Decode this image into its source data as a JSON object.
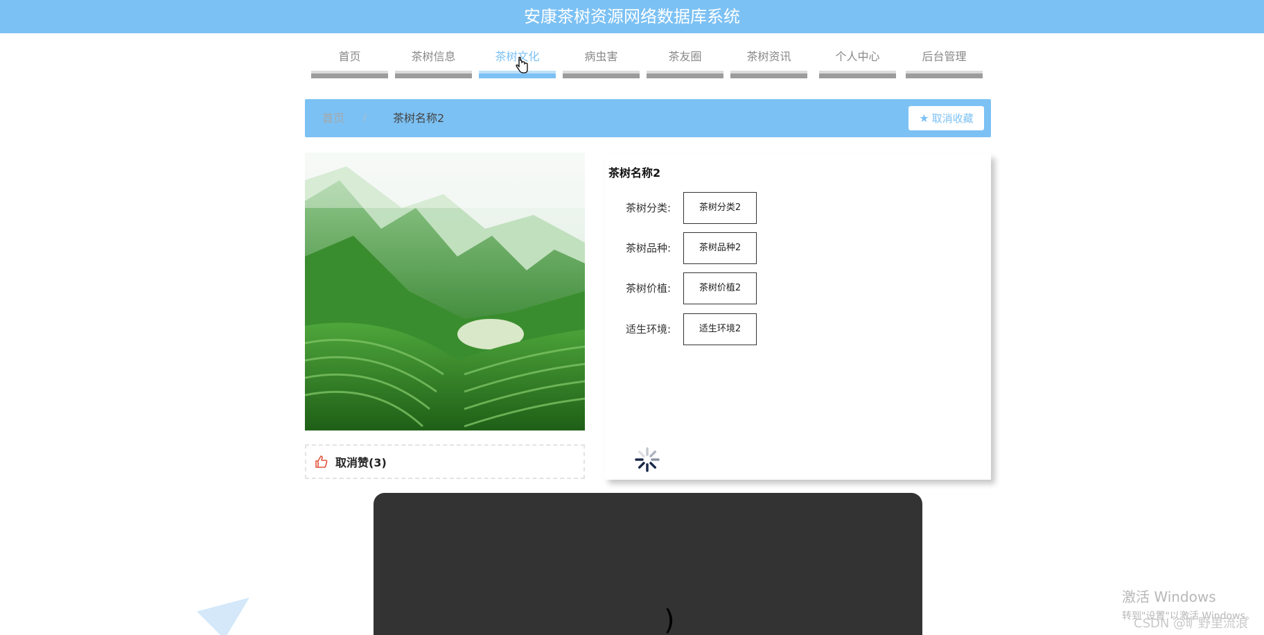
{
  "app": {
    "title": "安康茶树资源网络数据库系统"
  },
  "nav": {
    "items": [
      {
        "label": "首页"
      },
      {
        "label": "茶树信息"
      },
      {
        "label": "茶树文化"
      },
      {
        "label": "病虫害"
      },
      {
        "label": "茶友圈"
      },
      {
        "label": "茶树资讯"
      },
      {
        "label": "个人中心"
      },
      {
        "label": "后台管理"
      }
    ],
    "active_index": 2
  },
  "breadcrumb": {
    "home": "首页",
    "separator": "/",
    "current": "茶树名称2",
    "favorite_button": "取消收藏",
    "favorite_icon": "star-icon"
  },
  "photo": {
    "alt": "tea-plantation-image"
  },
  "like": {
    "label": "取消赞(3)",
    "icon": "thumbs-up-icon"
  },
  "detail": {
    "title": "茶树名称2",
    "fields": [
      {
        "label": "茶树分类:",
        "value": "茶树分类2"
      },
      {
        "label": "茶树品种:",
        "value": "茶树品种2"
      },
      {
        "label": "茶树价植:",
        "value": "茶树价植2"
      },
      {
        "label": "适生环境:",
        "value": "适生环境2"
      }
    ]
  },
  "overlay": {
    "glyph": ")"
  },
  "watermark": {
    "line1": "激活 Windows",
    "line2": "转到\"设置\"以激活 Windows。",
    "credit": "CSDN @旷野里流浪"
  },
  "colors": {
    "accent": "#7cc1f4",
    "dark_panel": "#333333",
    "like_icon": "#e2553d",
    "spinner": "#1b2a4a"
  }
}
